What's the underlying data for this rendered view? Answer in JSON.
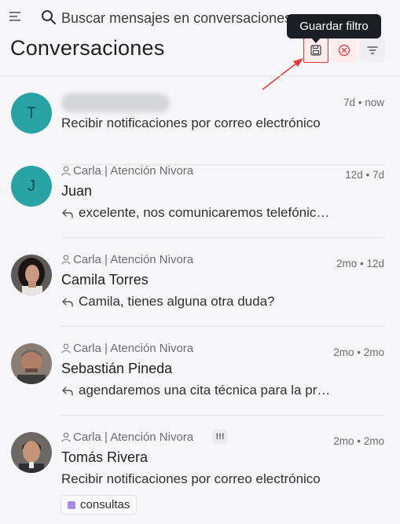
{
  "header": {
    "search_placeholder": "Buscar mensajes en conversaciones",
    "title": "Conversaciones",
    "tooltip": "Guardar filtro"
  },
  "toolbar": {
    "save_icon": "floppy-disk-icon",
    "clear_icon": "circle-x-icon",
    "filter_icon": "filter-lines-icon",
    "menu_icon": "hamburger-menu-icon",
    "search_icon": "search-icon"
  },
  "conversations": [
    {
      "avatar_letter": "T",
      "agent": "",
      "name": "",
      "preview": "Recibir notificaciones por correo electrónico",
      "reply": false,
      "time": "7d • now"
    },
    {
      "avatar_letter": "J",
      "agent": "Carla | Atención Nivora",
      "name": "Juan",
      "preview": "excelente, nos comunicaremos telefónicamente",
      "reply": true,
      "time": "12d • 7d"
    },
    {
      "avatar_letter": "",
      "agent": "Carla | Atención Nivora",
      "name": "Camila Torres",
      "preview": "Camila, tienes alguna otra duda?",
      "reply": true,
      "time": "2mo • 12d"
    },
    {
      "avatar_letter": "",
      "agent": "Carla | Atención Nivora",
      "name": "Sebastián Pineda",
      "preview": "agendaremos una cita técnica para la próxima semana",
      "reply": true,
      "time": "2mo • 2mo"
    },
    {
      "avatar_letter": "",
      "agent": "Carla | Atención Nivora",
      "name": "Tomás Rivera",
      "preview": "Recibir notificaciones por correo electrónico",
      "reply": false,
      "time": "2mo • 2mo",
      "priority": "!!!",
      "tag": "consultas"
    }
  ],
  "colors": {
    "accent_red": "#e53935",
    "avatar_teal": "#2aa3a4",
    "tag_purple": "#a78be4"
  }
}
